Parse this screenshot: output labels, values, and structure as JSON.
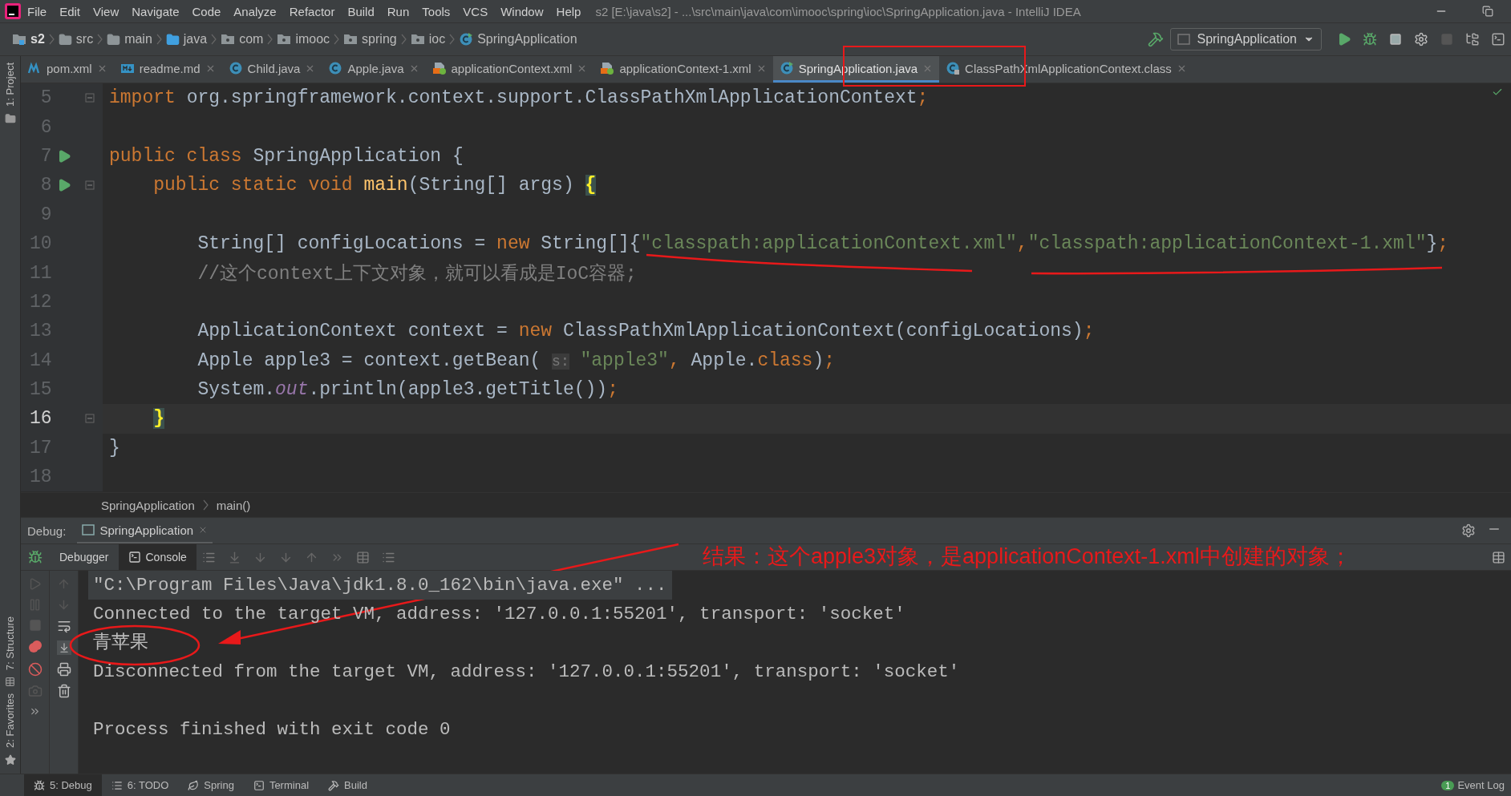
{
  "window": {
    "title": "s2 [E:\\java\\s2] - ...\\src\\main\\java\\com\\imooc\\spring\\ioc\\SpringApplication.java - IntelliJ IDEA"
  },
  "menu": [
    "File",
    "Edit",
    "View",
    "Navigate",
    "Code",
    "Analyze",
    "Refactor",
    "Build",
    "Run",
    "Tools",
    "VCS",
    "Window",
    "Help"
  ],
  "nav_path": [
    {
      "label": "s2",
      "kind": "project"
    },
    {
      "label": "src",
      "kind": "folder"
    },
    {
      "label": "main",
      "kind": "folder"
    },
    {
      "label": "java",
      "kind": "source"
    },
    {
      "label": "com",
      "kind": "package"
    },
    {
      "label": "imooc",
      "kind": "package"
    },
    {
      "label": "spring",
      "kind": "package"
    },
    {
      "label": "ioc",
      "kind": "package"
    },
    {
      "label": "SpringApplication",
      "kind": "class"
    }
  ],
  "run_config": {
    "label": "SpringApplication"
  },
  "editor_tabs": [
    {
      "label": "pom.xml",
      "kind": "maven",
      "selected": false
    },
    {
      "label": "readme.md",
      "kind": "markdown",
      "selected": false
    },
    {
      "label": "Child.java",
      "kind": "class",
      "selected": false
    },
    {
      "label": "Apple.java",
      "kind": "class",
      "selected": false
    },
    {
      "label": "applicationContext.xml",
      "kind": "xml",
      "selected": false
    },
    {
      "label": "applicationContext-1.xml",
      "kind": "xml",
      "selected": false
    },
    {
      "label": "SpringApplication.java",
      "kind": "runclass",
      "selected": true
    },
    {
      "label": "ClassPathXmlApplicationContext.class",
      "kind": "classfile",
      "selected": false
    }
  ],
  "editor": {
    "lines": [
      {
        "number": "5",
        "run": false,
        "fold": true,
        "current": false,
        "tokens": [
          {
            "text": "import",
            "kind": "keyword"
          },
          {
            "text": " org.springframework.context.support.ClassPathXmlApplicationContext",
            "kind": "plain"
          },
          {
            "text": ";",
            "kind": "keyword"
          }
        ]
      },
      {
        "number": "6",
        "run": false,
        "fold": false,
        "current": false
      },
      {
        "number": "7",
        "run": true,
        "fold": false,
        "current": false,
        "tokens": [
          {
            "text": "public class",
            "kind": "keyword"
          },
          {
            "text": " SpringApplication {",
            "kind": "plain"
          }
        ]
      },
      {
        "number": "8",
        "run": true,
        "fold": true,
        "current": false,
        "tokens": [
          {
            "text": "    public static void ",
            "kind": "keyword"
          },
          {
            "text": "main",
            "kind": "method"
          },
          {
            "text": "(String[] args) ",
            "kind": "plain"
          },
          {
            "text": "{",
            "kind": "brace"
          }
        ]
      },
      {
        "number": "9",
        "run": false,
        "fold": false,
        "current": false
      },
      {
        "number": "10",
        "run": false,
        "fold": false,
        "current": false,
        "tokens": [
          {
            "text": "        String[] configLocations = ",
            "kind": "plain"
          },
          {
            "text": "new",
            "kind": "keyword"
          },
          {
            "text": " String[]{",
            "kind": "plain"
          },
          {
            "text": "\"classpath:applicationContext.xml\"",
            "kind": "string"
          },
          {
            "text": ",",
            "kind": "keyword"
          },
          {
            "text": "\"classpath:applicationContext-1.xml\"",
            "kind": "string"
          },
          {
            "text": "}",
            "kind": "plain"
          },
          {
            "text": ";",
            "kind": "keyword"
          }
        ]
      },
      {
        "number": "11",
        "run": false,
        "fold": false,
        "current": false,
        "tokens": [
          {
            "text": "        //这个context上下文对象，就可以看成是IoC容器;",
            "kind": "comment"
          }
        ]
      },
      {
        "number": "12",
        "run": false,
        "fold": false,
        "current": false
      },
      {
        "number": "13",
        "run": false,
        "fold": false,
        "current": false,
        "tokens": [
          {
            "text": "        ApplicationContext context = ",
            "kind": "plain"
          },
          {
            "text": "new",
            "kind": "keyword"
          },
          {
            "text": " ClassPathXmlApplicationContext(configLocations)",
            "kind": "plain"
          },
          {
            "text": ";",
            "kind": "keyword"
          }
        ]
      },
      {
        "number": "14",
        "run": false,
        "fold": false,
        "current": false,
        "tokens": [
          {
            "text": "        Apple apple3 = context.getBean( ",
            "kind": "plain"
          },
          {
            "text": "s:",
            "kind": "hint"
          },
          {
            "text": " \"apple3\"",
            "kind": "string"
          },
          {
            "text": ",",
            "kind": "keyword"
          },
          {
            "text": " Apple.",
            "kind": "plain"
          },
          {
            "text": "class",
            "kind": "keyword"
          },
          {
            "text": ")",
            "kind": "plain"
          },
          {
            "text": ";",
            "kind": "keyword"
          }
        ]
      },
      {
        "number": "15",
        "run": false,
        "fold": false,
        "current": false,
        "tokens": [
          {
            "text": "        System.",
            "kind": "plain"
          },
          {
            "text": "out",
            "kind": "field"
          },
          {
            "text": ".println(apple3.getTitle())",
            "kind": "plain"
          },
          {
            "text": ";",
            "kind": "keyword"
          }
        ]
      },
      {
        "number": "16",
        "run": false,
        "fold": true,
        "current": true,
        "tokens": [
          {
            "text": "    }",
            "kind": "brace"
          }
        ]
      },
      {
        "number": "17",
        "run": false,
        "fold": false,
        "current": false,
        "tokens": [
          {
            "text": "}",
            "kind": "plain"
          }
        ]
      },
      {
        "number": "18",
        "run": false,
        "fold": false,
        "current": false
      }
    ]
  },
  "breadcrumb": [
    "SpringApplication",
    "main()"
  ],
  "debug": {
    "label": "Debug:",
    "session": "SpringApplication",
    "tabs": [
      {
        "label": "Debugger",
        "selected": false
      },
      {
        "label": "Console",
        "selected": true
      }
    ],
    "console": [
      {
        "text": "\"C:\\Program Files\\Java\\jdk1.8.0_162\\bin\\java.exe\" ...",
        "kind": "command"
      },
      {
        "text": "Connected to the target VM, address: '127.0.0.1:55201', transport: 'socket'",
        "kind": "plain"
      },
      {
        "text": "青苹果",
        "kind": "plain"
      },
      {
        "text": "Disconnected from the target VM, address: '127.0.0.1:55201', transport: 'socket'",
        "kind": "plain"
      },
      {
        "text": "Process finished with exit code 0",
        "kind": "exit"
      }
    ]
  },
  "annotation": {
    "text": "结果：这个apple3对象，是applicationContext-1.xml中创建的对象；"
  },
  "side_tools": {
    "top": [
      "1: Project"
    ],
    "bottom": [
      "7: Structure",
      "2: Favorites"
    ]
  },
  "bottom_tools": [
    {
      "label": "5: Debug",
      "selected": true
    },
    {
      "label": "6: TODO",
      "selected": false
    },
    {
      "label": "Spring",
      "selected": false
    },
    {
      "label": "Terminal",
      "selected": false
    },
    {
      "label": "Build",
      "selected": false
    }
  ],
  "event_log": {
    "label": "Event Log",
    "count": "1"
  }
}
